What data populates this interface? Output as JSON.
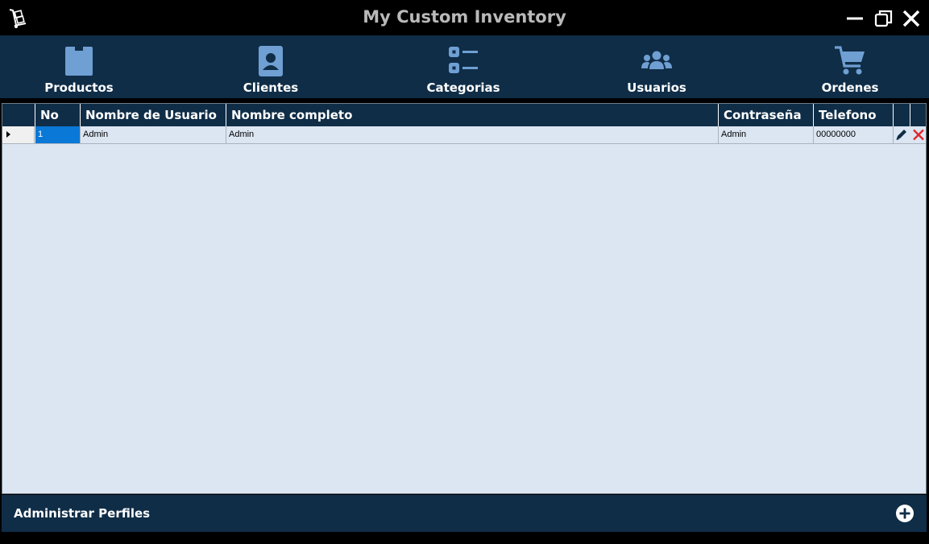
{
  "window": {
    "title": "My Custom Inventory",
    "app_icon": "hand-truck-icon",
    "controls": [
      "minimize-icon",
      "restore-icon",
      "close-icon"
    ]
  },
  "nav": {
    "items": [
      {
        "label": "Productos",
        "icon": "box-icon"
      },
      {
        "label": "Clientes",
        "icon": "contact-card-icon"
      },
      {
        "label": "Categorias",
        "icon": "list-icon"
      },
      {
        "label": "Usuarios",
        "icon": "users-icon"
      },
      {
        "label": "Ordenes",
        "icon": "cart-icon"
      }
    ]
  },
  "grid": {
    "columns": [
      "No",
      "Nombre de Usuario",
      "Nombre completo",
      "Contraseña",
      "Telefono",
      "",
      ""
    ],
    "rows": [
      {
        "no": "1",
        "usuario": "Admin",
        "completo": "Admin",
        "contrasena": "Admin",
        "telefono": "00000000",
        "edit_icon": "pencil-icon",
        "delete_icon": "delete-x-icon"
      }
    ]
  },
  "footer": {
    "title": "Administrar Perfiles",
    "add_icon": "plus-circle-icon"
  },
  "colors": {
    "navy": "#0f2d47",
    "icon_blue": "#6f9fd3",
    "grid_bg": "#dce6f2",
    "selection": "#0a78d7",
    "title_gray": "#b9b9b9",
    "delete_red": "#e0282e"
  }
}
